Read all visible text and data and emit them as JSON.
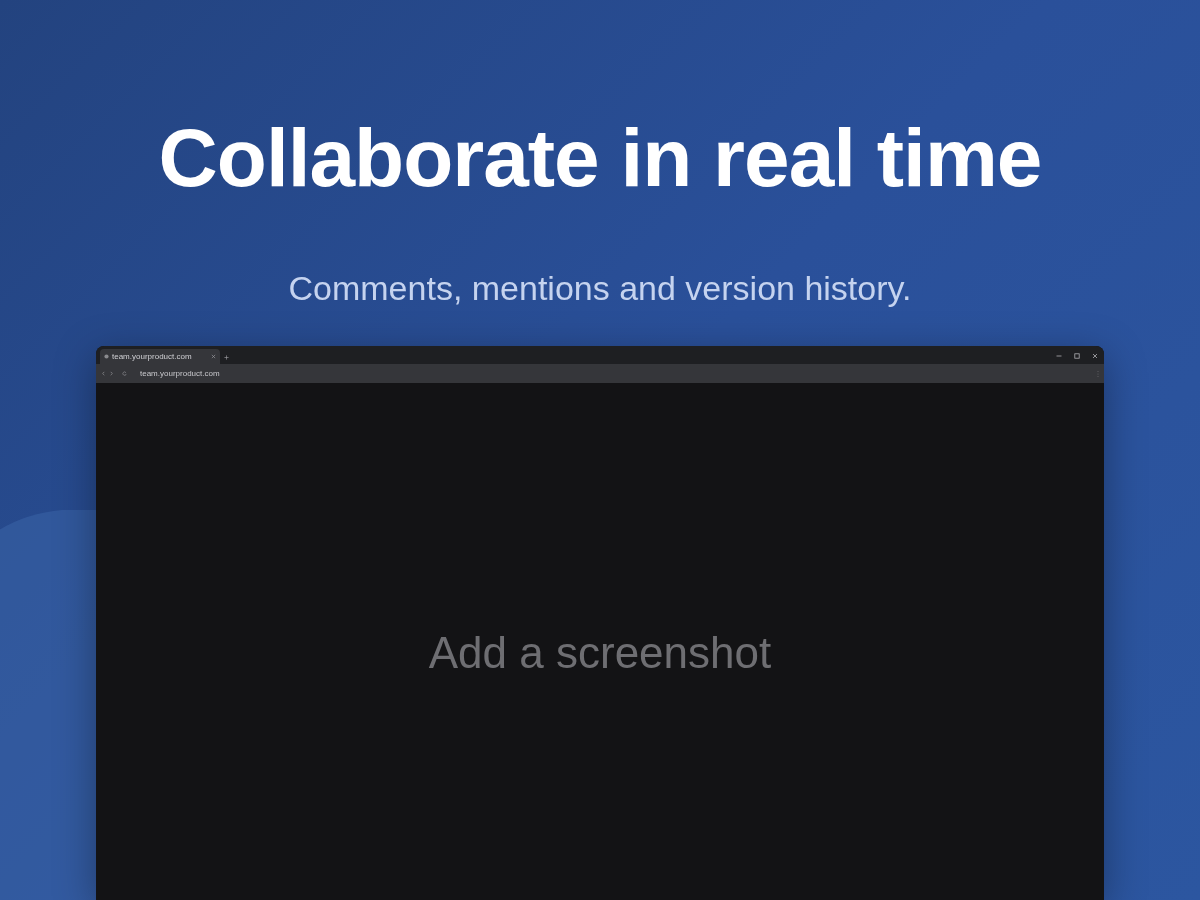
{
  "headline": "Collaborate in real time",
  "subtitle": "Comments, mentions and version history.",
  "browser": {
    "tab": {
      "title": "team.yourproduct.com"
    },
    "address": "team.yourproduct.com",
    "content": {
      "placeholder_text": "Add a screenshot"
    }
  }
}
